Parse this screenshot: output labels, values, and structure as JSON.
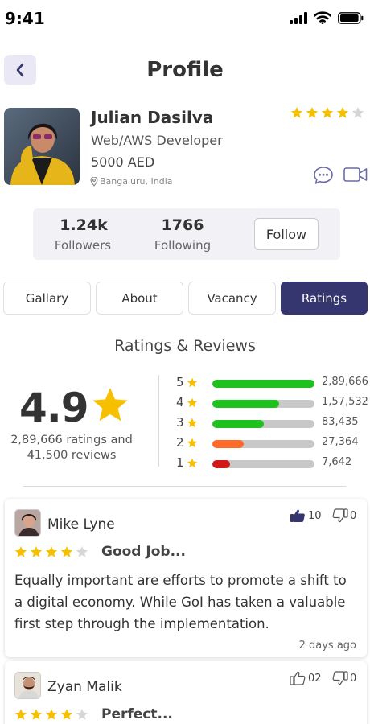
{
  "status_bar": {
    "time": "9:41"
  },
  "header": {
    "title": "Profile"
  },
  "profile": {
    "name": "Julian Dasilva",
    "role": "Web/AWS Developer",
    "salary": "5000 AED",
    "location": "Bangaluru, India",
    "rating_stars": 4
  },
  "stats": {
    "followers_count": "1.24k",
    "followers_label": "Followers",
    "following_count": "1766",
    "following_label": "Following",
    "follow_label": "Follow"
  },
  "tabs": [
    {
      "label": "Gallary",
      "active": false
    },
    {
      "label": "About",
      "active": false
    },
    {
      "label": "Vacancy",
      "active": false
    },
    {
      "label": "Ratings",
      "active": true
    }
  ],
  "ratings": {
    "section_title": "Ratings & Reviews",
    "average": "4.9",
    "ratings_line": "2,89,666 ratings and",
    "reviews_line": "41,500 reviews",
    "distribution": [
      {
        "stars": "5",
        "count": "2,89,666",
        "fraction": 1.0,
        "color": "#1fc11f"
      },
      {
        "stars": "4",
        "count": "1,57,532",
        "fraction": 0.65,
        "color": "#1fc11f"
      },
      {
        "stars": "3",
        "count": "83,435",
        "fraction": 0.5,
        "color": "#1fc11f"
      },
      {
        "stars": "2",
        "count": "27,364",
        "fraction": 0.31,
        "color": "#ff6a2b"
      },
      {
        "stars": "1",
        "count": "7,642",
        "fraction": 0.17,
        "color": "#d11818"
      }
    ]
  },
  "reviews": [
    {
      "name": "Mike Lyne",
      "likes": "10",
      "dislikes": "0",
      "stars": 4,
      "headline": "Good Job...",
      "body": "Equally important are efforts to promote a shift to a digital economy. While GoI has taken a valuable first step through the implementation.",
      "time": "2 days ago",
      "liked": true
    },
    {
      "name": "Zyan Malik",
      "likes": "02",
      "dislikes": "0",
      "stars": 4,
      "headline": "Perfect...",
      "body": "",
      "time": "",
      "liked": false
    }
  ],
  "colors": {
    "accent": "#35356f",
    "star": "#f6c000",
    "star_empty": "#d6d6d6"
  }
}
